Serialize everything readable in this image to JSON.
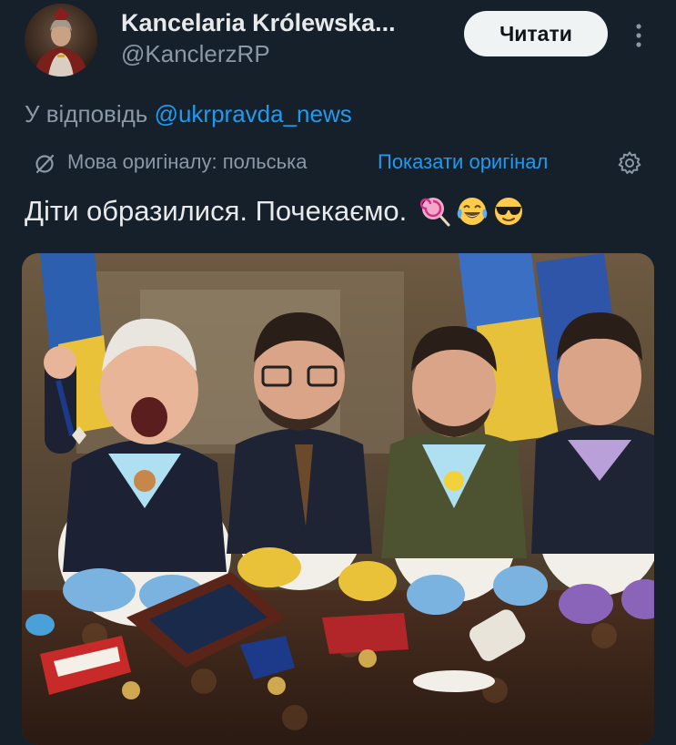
{
  "account": {
    "display_name": "Kancelaria Królewska...",
    "handle": "@KanclerzRP",
    "follow_label": "Читати"
  },
  "reply": {
    "prefix": "У відповідь ",
    "mention": "@ukrpravda_news"
  },
  "translation": {
    "label": "Мова оригіналу: польська",
    "show_original": "Показати оригінал"
  },
  "tweet": {
    "text": "Діти образилися. Почекаємо."
  },
  "icons": {
    "more": "more-vertical-icon",
    "translate": "translate-slash-icon",
    "settings": "gear-icon",
    "emojis": [
      "lollipop-emoji",
      "tears-of-joy-emoji",
      "sunglasses-emoji"
    ]
  },
  "colors": {
    "background": "#15202b",
    "primary_text": "#e7e9ea",
    "secondary_text": "#8b98a5",
    "link": "#1d9bf0",
    "button_bg": "#eff3f4"
  }
}
